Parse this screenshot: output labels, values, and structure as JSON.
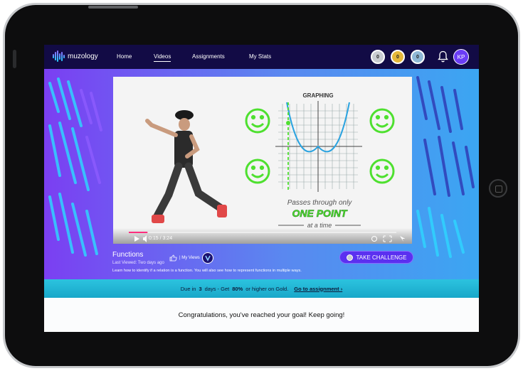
{
  "nav": {
    "logo_text": "muzology",
    "items": [
      {
        "label": "Home",
        "active": false
      },
      {
        "label": "Videos",
        "active": true
      },
      {
        "label": "Assignments",
        "active": false
      },
      {
        "label": "My Stats",
        "active": false
      }
    ],
    "medals": [
      {
        "name": "silver-medal",
        "color": "#c9ccd1",
        "count": "0"
      },
      {
        "name": "gold-medal",
        "color": "#e6b83a",
        "count": "0"
      },
      {
        "name": "platinum-medal",
        "color": "#8fb8d6",
        "count": "0"
      }
    ],
    "avatar_initials": "KP"
  },
  "video": {
    "graph_title": "GRAPHING",
    "caption_line1": "Passes through only",
    "caption_highlight": "ONE POINT",
    "caption_line3": "at a time",
    "time": "0:15 / 3:24",
    "progress": 0.07
  },
  "info": {
    "title": "Functions",
    "my_views_label": "| My Views",
    "last_viewed": "Last Viewed: Two days ago",
    "description": "Learn how to identify if a relation is a function. You will also see how to represent functions in multiple ways.",
    "challenge_label": "TAKE CHALLENGE"
  },
  "banner": {
    "due_prefix": "Due in",
    "due_days": "3",
    "due_mid": "days - Get",
    "percent": "80%",
    "due_suffix": "or higher on Gold.",
    "link_label": "Go to assignment ›"
  },
  "congrats": "Congratulations, you've reached your goal!  Keep going!",
  "colors": {
    "nav_bg": "#120b45",
    "accent": "#5b30f0",
    "banner": "#2cc3df",
    "smiley": "#4ee02f"
  }
}
